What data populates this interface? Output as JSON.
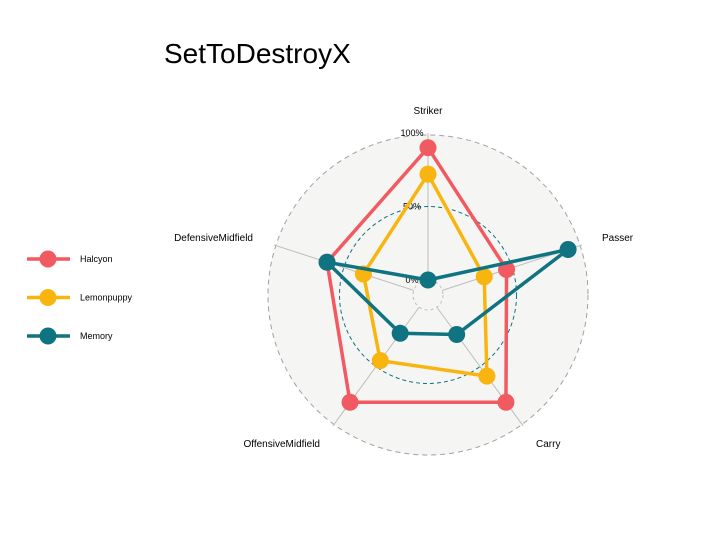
{
  "chart_data": {
    "type": "radar",
    "title": "SetToDestroyX",
    "axes": [
      "Striker",
      "Passer",
      "Carry",
      "OffensiveMidfield",
      "DefensiveMidfield"
    ],
    "grid_labels": [
      "0%",
      "50%",
      "100%"
    ],
    "grid_values": [
      0,
      0.5,
      1
    ],
    "range": [
      0,
      1
    ],
    "legend_position": "left",
    "series": [
      {
        "name": "Halcyon",
        "color": "#F25A62",
        "values": [
          0.9,
          0.46,
          0.8,
          0.8,
          0.62
        ]
      },
      {
        "name": "Lemonpuppy",
        "color": "#F8B50F",
        "values": [
          0.72,
          0.3,
          0.58,
          0.45,
          0.36
        ]
      },
      {
        "name": "Memory",
        "color": "#0F7381",
        "values": [
          0.0,
          0.9,
          0.23,
          0.22,
          0.62
        ]
      }
    ]
  }
}
